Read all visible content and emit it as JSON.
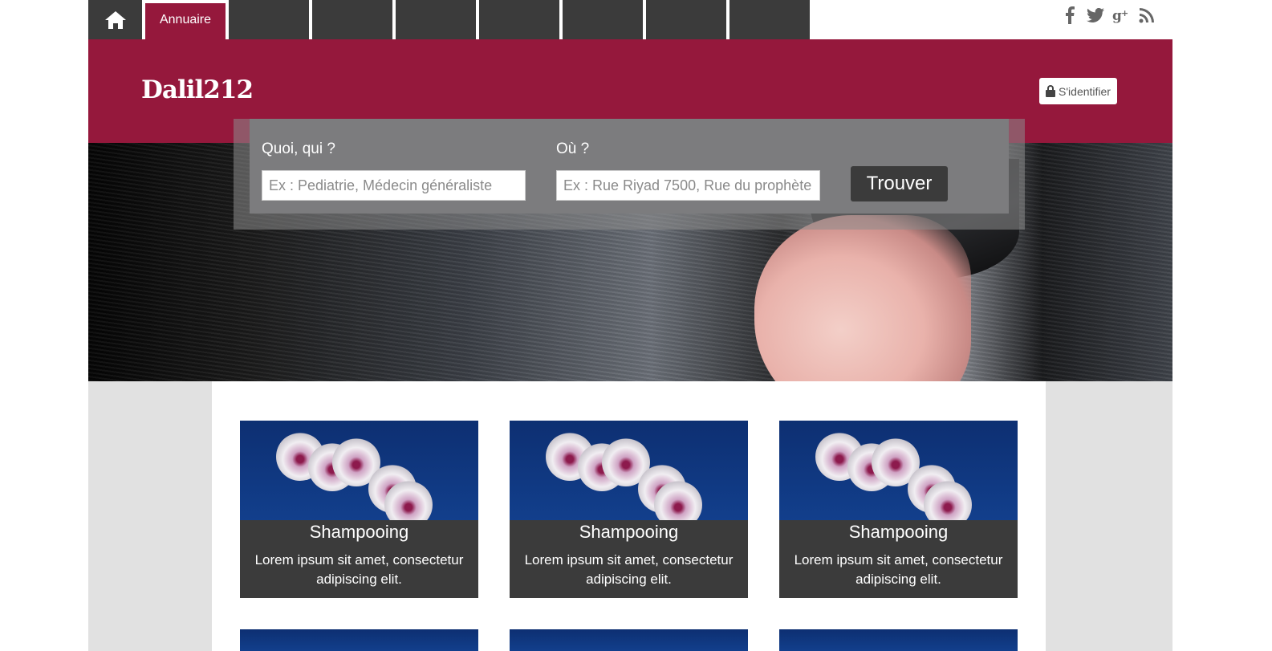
{
  "nav": {
    "tabs": [
      {
        "label": "Annuaire",
        "active": true
      }
    ],
    "empty_tab_count": 7,
    "social": [
      "facebook-icon",
      "twitter-icon",
      "google-plus-icon",
      "rss-icon"
    ],
    "social_glyphs": {
      "facebook": "f",
      "twitter": "t",
      "google_plus": "g+",
      "rss": "rss"
    }
  },
  "header": {
    "logo": "Dalil212",
    "login_label": "S'identifier"
  },
  "search": {
    "what_label": "Quoi, qui ?",
    "what_placeholder": "Ex : Pediatrie, Médecin généraliste",
    "where_label": "Où ?",
    "where_placeholder": "Ex : Rue Riyad 7500, Rue du prophète",
    "submit_label": "Trouver"
  },
  "cards": [
    {
      "title": "Shampooing",
      "description": "Lorem ipsum sit amet, consectetur adipiscing elit."
    },
    {
      "title": "Shampooing",
      "description": "Lorem ipsum sit amet, consectetur adipiscing elit."
    },
    {
      "title": "Shampooing",
      "description": "Lorem ipsum sit amet, consectetur adipiscing elit."
    }
  ],
  "colors": {
    "brand": "#95183c",
    "dark": "#3b3b3b",
    "search_panel": "#7c7c7e",
    "page_side": "#e1e1e1"
  }
}
